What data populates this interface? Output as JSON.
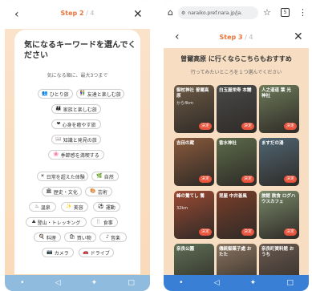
{
  "left": {
    "step_current": "Step 2",
    "step_total": " / 4",
    "title": "気になるキーワードを選んでください",
    "note": "気になる順に、最大3つまで",
    "chips": [
      {
        "icon": "👥",
        "label": "ひとり旅"
      },
      {
        "icon": "👫",
        "label": "友達と楽しむ旅"
      },
      {
        "icon": "👨‍👩‍👧",
        "label": "家族と楽しむ旅"
      },
      {
        "icon": "❤",
        "label": "心身を癒やす旅"
      },
      {
        "icon": "📖",
        "label": "知識と発見の旅"
      },
      {
        "icon": "🌸",
        "label": "季節感を満喫する"
      },
      {
        "icon": "☀",
        "label": "日常を超えた体験"
      },
      {
        "icon": "🌿",
        "label": "自然"
      },
      {
        "icon": "🏛",
        "label": "歴史・文化"
      },
      {
        "icon": "🎨",
        "label": "芸術"
      },
      {
        "icon": "♨",
        "label": "温泉"
      },
      {
        "icon": "✨",
        "label": "美容"
      },
      {
        "icon": "⚽",
        "label": "運動"
      },
      {
        "icon": "⛰",
        "label": "登山・トレッキング"
      },
      {
        "icon": "🍴",
        "label": "食事"
      },
      {
        "icon": "🍳",
        "label": "料理"
      },
      {
        "icon": "🛍",
        "label": "買い物"
      },
      {
        "icon": "♪",
        "label": "音楽"
      },
      {
        "icon": "📷",
        "label": "カメラ"
      },
      {
        "icon": "🚗",
        "label": "ドライブ"
      }
    ]
  },
  "right": {
    "url": "naraiko.pref.nara.jp/ja.",
    "tab_count": "5",
    "step_current": "Step 3",
    "step_total": " / 4",
    "title": "曽爾高原 に行くならこちらもおすすめ",
    "subtitle": "行ってみたいところを１つ選んでください",
    "tiles": [
      {
        "label": "御杖神社 曽爾高原",
        "sub": "から4km",
        "button": "決定",
        "color": "#6d5a45"
      },
      {
        "label": "白玉屋栄寿 本舗",
        "sub": "",
        "button": "決定",
        "color": "#4a4a4a"
      },
      {
        "label": "人之道道 葉 光 神社",
        "sub": "",
        "button": "決定",
        "color": "#6e7b5a"
      },
      {
        "label": "吉田の蔵",
        "sub": "",
        "button": "決定",
        "color": "#8a5a3c"
      },
      {
        "label": "香水神社",
        "sub": "",
        "button": "決定",
        "color": "#5c6b4a"
      },
      {
        "label": "ますだの湯",
        "sub": "",
        "button": "決定",
        "color": "#4f6673"
      },
      {
        "label": "峰の鶯てし 鶯",
        "sub": "32km",
        "button": "決定",
        "color": "#9c4a33"
      },
      {
        "label": "昆屋 中井善風",
        "sub": "",
        "button": "決定",
        "color": "#7b3e2a"
      },
      {
        "label": "旅館 飲食 ログハウスカフェ",
        "sub": "",
        "button": "決定",
        "color": "#7a8a6a"
      },
      {
        "label": "奈良公園",
        "sub": "",
        "button": "決定",
        "color": "#5e6e55"
      },
      {
        "label": "傳統御菓子處 おたた",
        "sub": "",
        "button": "決定",
        "color": "#8a7460"
      },
      {
        "label": "奈良町資料館 おうち",
        "sub": "",
        "button": "決定",
        "color": "#6a5a50"
      }
    ]
  }
}
